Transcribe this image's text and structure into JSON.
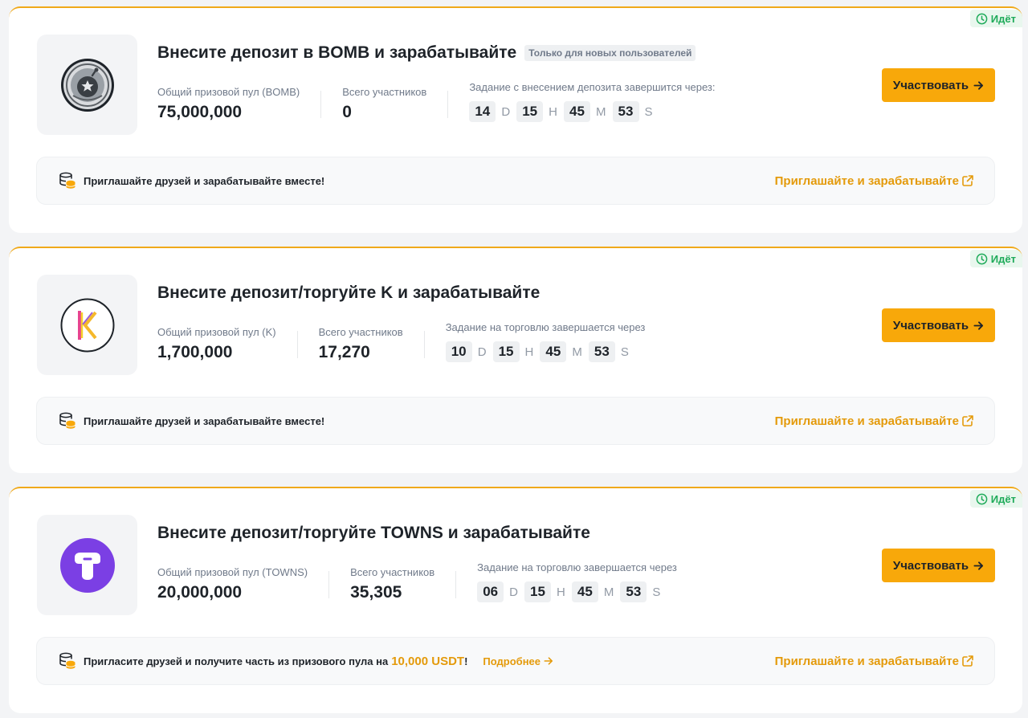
{
  "colors": {
    "accent": "#f8a80a",
    "link": "#e49a0a",
    "status": "#1fab5a"
  },
  "campaigns": [
    {
      "status": "Идёт",
      "logo": "bomb-token-icon",
      "title": "Внесите депозит в BOMB и зарабатывайте",
      "tag": "Только для новых пользователей",
      "pool_label": "Общий призовой пул (BOMB)",
      "pool_value": "75,000,000",
      "participants_label": "Всего участников",
      "participants_value": "0",
      "timer_label": "Задание с внесением депозита завершится через:",
      "countdown": {
        "d": "14",
        "h": "15",
        "m": "45",
        "s": "53"
      },
      "button": "Участвовать",
      "invite_text": "Приглашайте друзей и зарабатывайте вместе!",
      "invite_link": "Приглашайте и зарабатывайте"
    },
    {
      "status": "Идёт",
      "logo": "k-token-icon",
      "title": "Внесите депозит/торгуйте K и зарабатывайте",
      "tag": "",
      "pool_label": "Общий призовой пул (K)",
      "pool_value": "1,700,000",
      "participants_label": "Всего участников",
      "participants_value": "17,270",
      "timer_label": "Задание на торговлю завершается через",
      "countdown": {
        "d": "10",
        "h": "15",
        "m": "45",
        "s": "53"
      },
      "button": "Участвовать",
      "invite_text": "Приглашайте друзей и зарабатывайте вместе!",
      "invite_link": "Приглашайте и зарабатывайте"
    },
    {
      "status": "Идёт",
      "logo": "towns-token-icon",
      "title": "Внесите депозит/торгуйте TOWNS и зарабатывайте",
      "tag": "",
      "pool_label": "Общий призовой пул (TOWNS)",
      "pool_value": "20,000,000",
      "participants_label": "Всего участников",
      "participants_value": "35,305",
      "timer_label": "Задание на торговлю завершается через",
      "countdown": {
        "d": "06",
        "h": "15",
        "m": "45",
        "s": "53"
      },
      "button": "Участвовать",
      "invite_text": "Пригласите друзей и получите часть из призового пула на",
      "invite_amount": "10,000 USDT",
      "invite_excl": "!",
      "more_link": "Подробнее",
      "invite_link": "Приглашайте и зарабатывайте"
    }
  ],
  "units": {
    "d": "D",
    "h": "H",
    "m": "M",
    "s": "S"
  }
}
